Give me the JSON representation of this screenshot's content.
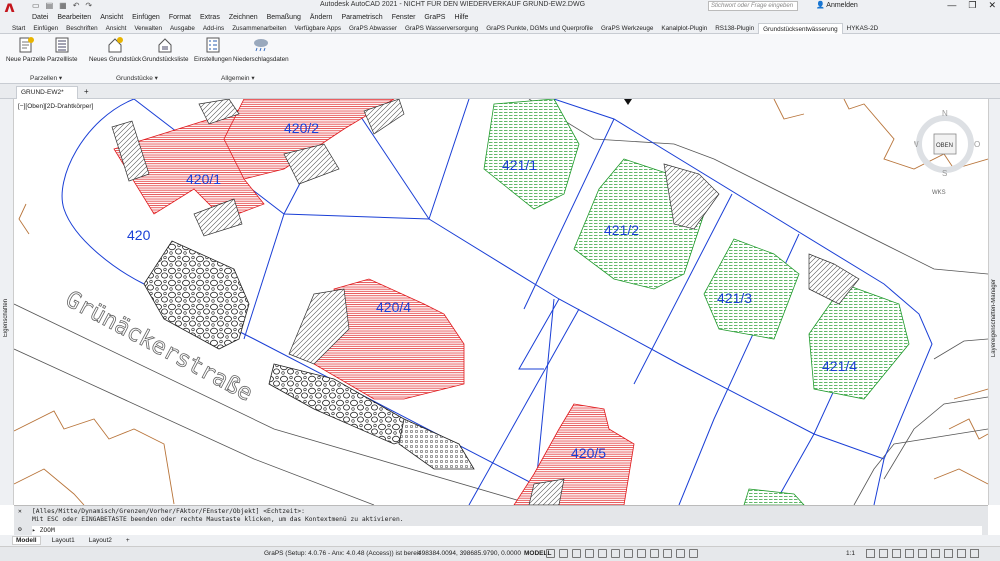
{
  "app": {
    "title": "Autodesk AutoCAD 2021 - NICHT FÜR DEN WIEDERVERKAUF   GRUND-EW2.DWG",
    "search_placeholder": "Stichwort oder Frage eingeben",
    "signin": "Anmelden"
  },
  "menu": [
    "Datei",
    "Bearbeiten",
    "Ansicht",
    "Einfügen",
    "Format",
    "Extras",
    "Zeichnen",
    "Bemaßung",
    "Ändern",
    "Parametrisch",
    "Fenster",
    "GraPS",
    "Hilfe"
  ],
  "ribbon_tabs": [
    "Start",
    "Einfügen",
    "Beschriften",
    "Ansicht",
    "Verwalten",
    "Ausgabe",
    "Add-ins",
    "Zusammenarbeiten",
    "Verfügbare Apps",
    "GraPS Abwasser",
    "GraPS Wasserversorgung",
    "GraPS Punkte, DGMs und Querprofile",
    "GraPS Werkzeuge",
    "Kanalplot-Plugin",
    "RS138-Plugin",
    "Grundstücksentwässerung",
    "HYKAS-2D"
  ],
  "active_tab": "Grundstücksentwässerung",
  "ribbon": {
    "buttons": [
      "Neue Parzelle",
      "Parzellliste",
      "Neues Grundstück",
      "Grundstücksliste",
      "Einstellungen",
      "Niederschlagsdaten"
    ],
    "panels": [
      "Parzellen",
      "Grundstücke",
      "Allgemein"
    ]
  },
  "file_tab": "GRUND-EW2*",
  "viewport_label": "[−][Oben][2D-Drahtkörper]",
  "side_panels": {
    "left": "Eigenschaften",
    "right": "Layereigenschaften-Manager"
  },
  "viewcube": {
    "face": "OBEN",
    "n": "N",
    "s": "S",
    "w": "W",
    "o": "O",
    "wcs": "WKS"
  },
  "drawing": {
    "parcels": [
      "420/1",
      "420/2",
      "420/4",
      "420/5",
      "421/1",
      "421/2",
      "421/3",
      "421/4",
      "420"
    ],
    "street": "Grünäckerstraße"
  },
  "command": {
    "history_1": "[Alles/Mitte/Dynamisch/Grenzen/Vorher/FAktor/FEnster/Objekt] <Echtzeit>:",
    "history_2": "Mit ESC oder EINGABETASTE beenden oder rechte Maustaste klicken, um das Kontextmenü zu aktivieren.",
    "prompt": "ZOOM"
  },
  "layout_tabs": [
    "Modell",
    "Layout1",
    "Layout2"
  ],
  "status": {
    "graps": "GraPS (Setup: 4.0.76 - Anx: 4.0.48 (Access)) ist bereit",
    "coords": "498384.0094, 398685.9790, 0.0000",
    "mode": "MODELL",
    "scale": "1:1"
  },
  "colors": {
    "red": "#e0191c",
    "green": "#1e9a2a",
    "blue": "#1a3fd6",
    "gray": "#444444",
    "orange": "#b8743a"
  }
}
